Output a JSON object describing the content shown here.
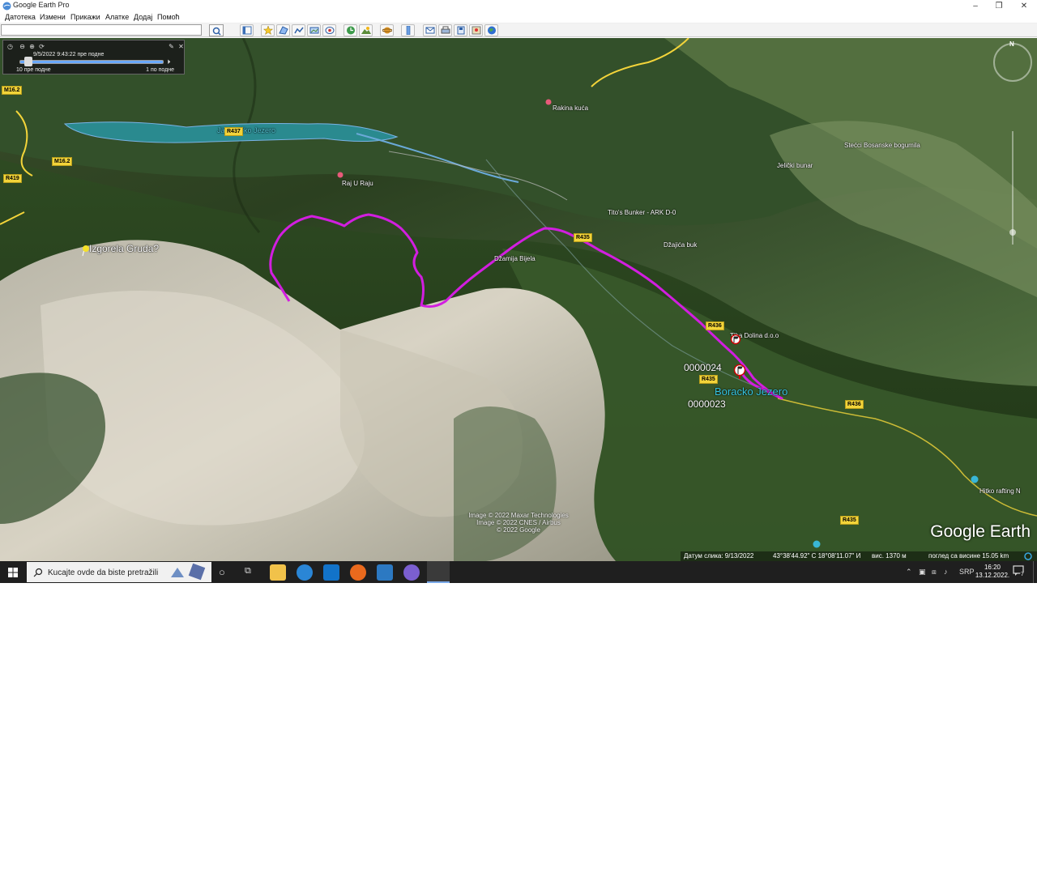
{
  "window": {
    "title": "Google Earth Pro",
    "minimize": "–",
    "restore": "❐",
    "close": "✕"
  },
  "menu": [
    "Датотека",
    "Измени",
    "Прикажи",
    "Алатке",
    "Додај",
    "Помоћ"
  ],
  "search": {
    "value": "",
    "placeholder": ""
  },
  "toolbar_icons": [
    "sidebar-icon",
    "placemark-icon",
    "polygon-icon",
    "path-icon",
    "image-overlay-icon",
    "record-tour-icon",
    "historical-imagery-icon",
    "sun-icon",
    "planets-icon",
    "ruler-icon",
    "email-icon",
    "print-icon",
    "save-image-icon",
    "view-in-maps-icon",
    "earth-icon"
  ],
  "time_slider": {
    "date": "9/5/2022   9:43:22 пре подне",
    "start": "10 пре подне",
    "end": "1 по подне"
  },
  "map_labels": {
    "lake_top": "Jablaničko Jezero",
    "raj": "Raj U Raju",
    "izgorela": "Izgorela Gruda?",
    "dzamija": "Džamija Bijela",
    "tito": "Tito's Bunker - ARK D-0",
    "dzajica": "Džajića buk",
    "tiha": "Tiha Dolina d.o.o",
    "p24": "0000024",
    "p23": "0000023",
    "boracko": "Boracko Jezero",
    "hitko": "Hitko rafting N",
    "stecci": "Stećci Bosanske bogumila",
    "jelicki": "Jelički bunar",
    "rakina": "Rakina kuća"
  },
  "roads": {
    "r435a": "R435",
    "r435b": "R435",
    "r436a": "R436",
    "r436b": "R436",
    "r435c": "R435",
    "r419": "R419",
    "m162": "M16.2",
    "m16": "M16.2",
    "r437": "R437"
  },
  "attribution": {
    "line1": "Image © 2022 Maxar Technologies",
    "line2": "Image © 2022 CNES / Airbus",
    "line3": "© 2022 Google"
  },
  "watermark": "Google Earth",
  "status": {
    "date": "Датум слика: 9/13/2022",
    "coords": "43°38'44.92\" С   18°08'11.07\" И",
    "elev": "вис. 1370 м",
    "eye": "поглед са висине   15.05 km"
  },
  "taskbar": {
    "search_placeholder": "Kucajte ovde da biste pretražili",
    "lang": "SRP",
    "time": "16:20",
    "date": "13.12.2022.",
    "notif_count": "7"
  },
  "colors": {
    "track": "#d21ee0",
    "road": "#f3d43a",
    "lake": "#37c6e0"
  }
}
